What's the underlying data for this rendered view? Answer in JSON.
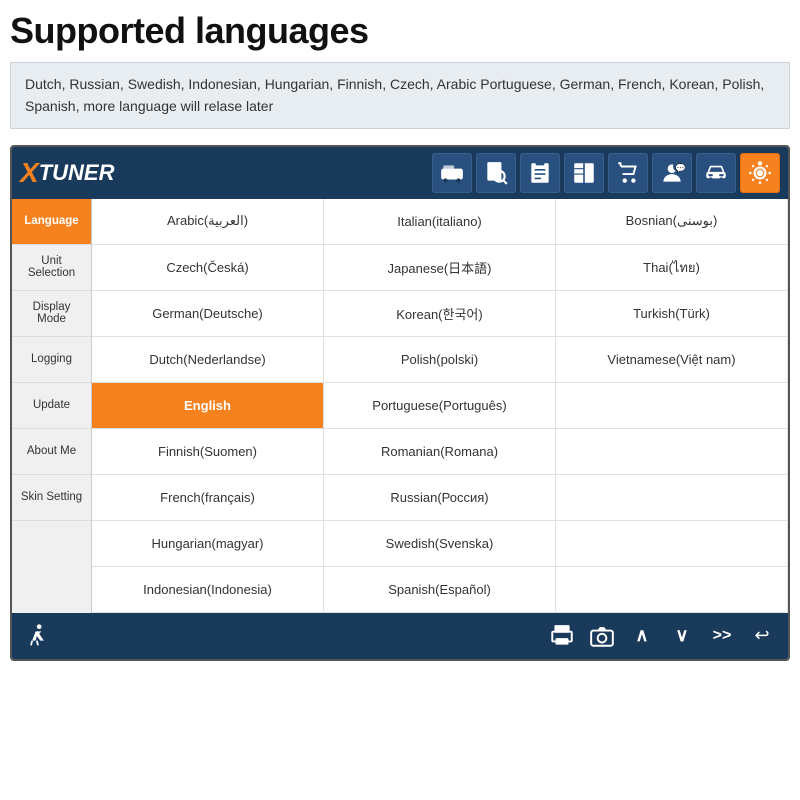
{
  "page": {
    "title": "Supported languages",
    "subtitle": "Dutch, Russian, Swedish, Indonesian, Hungarian, Finnish, Czech, Arabic\nPortuguese, German, French, Korean, Polish, Spanish, more language will relase later"
  },
  "app": {
    "logo_x": "X",
    "logo_tuner": "TUNER"
  },
  "sidebar": {
    "items": [
      {
        "id": "language",
        "label": "Language",
        "active": true
      },
      {
        "id": "unit-selection",
        "label": "Unit Selection",
        "active": false
      },
      {
        "id": "display-mode",
        "label": "Display Mode",
        "active": false
      },
      {
        "id": "logging",
        "label": "Logging",
        "active": false
      },
      {
        "id": "update",
        "label": "Update",
        "active": false
      },
      {
        "id": "about-me",
        "label": "About Me",
        "active": false
      },
      {
        "id": "skin-setting",
        "label": "Skin Setting",
        "active": false
      }
    ]
  },
  "languages": {
    "grid": [
      [
        "Arabic(العربية)",
        "Italian(italiano)",
        "Bosnian(بوسنی)"
      ],
      [
        "Czech(Česká)",
        "Japanese(日本語)",
        "Thai(ไทย)"
      ],
      [
        "German(Deutsche)",
        "Korean(한국어)",
        "Turkish(Türk)"
      ],
      [
        "Dutch(Nederlandse)",
        "Polish(polski)",
        "Vietnamese(Việt nam)"
      ],
      [
        "English",
        "Portuguese(Português)",
        ""
      ],
      [
        "Finnish(Suomen)",
        "Romanian(Romana)",
        ""
      ],
      [
        "French(français)",
        "Russian(Россия)",
        ""
      ],
      [
        "Hungarian(magyar)",
        "Swedish(Svenska)",
        ""
      ],
      [
        "Indonesian(Indonesia)",
        "Spanish(Español)",
        ""
      ]
    ],
    "selected": "English"
  },
  "toolbar_icons": [
    {
      "name": "vehicle-icon",
      "symbol": "🚌"
    },
    {
      "name": "search-icon",
      "symbol": "🔍"
    },
    {
      "name": "document-icon",
      "symbol": "📋"
    },
    {
      "name": "book-icon",
      "symbol": "📖"
    },
    {
      "name": "cart-icon",
      "symbol": "🛒"
    },
    {
      "name": "user-icon",
      "symbol": "👤"
    },
    {
      "name": "car-icon",
      "symbol": "🚗"
    },
    {
      "name": "settings-icon",
      "symbol": "⚙️"
    }
  ],
  "bottom_icons": [
    {
      "name": "run-icon",
      "symbol": "🏃"
    },
    {
      "name": "print-icon",
      "symbol": "🖨"
    },
    {
      "name": "camera-icon",
      "symbol": "📷"
    },
    {
      "name": "up-icon",
      "symbol": "∧"
    },
    {
      "name": "down-icon",
      "symbol": "∨"
    },
    {
      "name": "forward-icon",
      "symbol": ">>"
    },
    {
      "name": "back-icon",
      "symbol": "↩"
    }
  ]
}
